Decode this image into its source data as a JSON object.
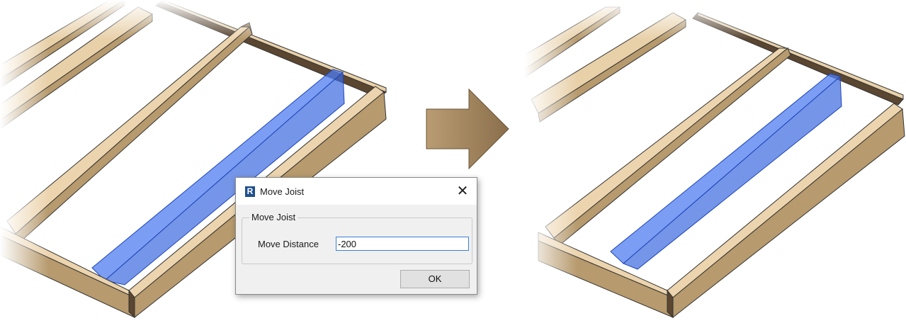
{
  "dialog": {
    "title": "Move Joist",
    "app_icon_letter": "R",
    "close_symbol": "✕",
    "group_label": "Move Joist",
    "field_label": "Move Distance",
    "field_value": "-200",
    "ok_label": "OK"
  },
  "colors": {
    "wood_top": "#ecd4ae",
    "wood_side": "#b79a6d",
    "wood_dark": "#5a4631",
    "highlight": "#3f6fe0"
  },
  "icons": {
    "transition": "right-arrow-icon",
    "app": "revit-logo-icon",
    "close": "close-icon"
  }
}
